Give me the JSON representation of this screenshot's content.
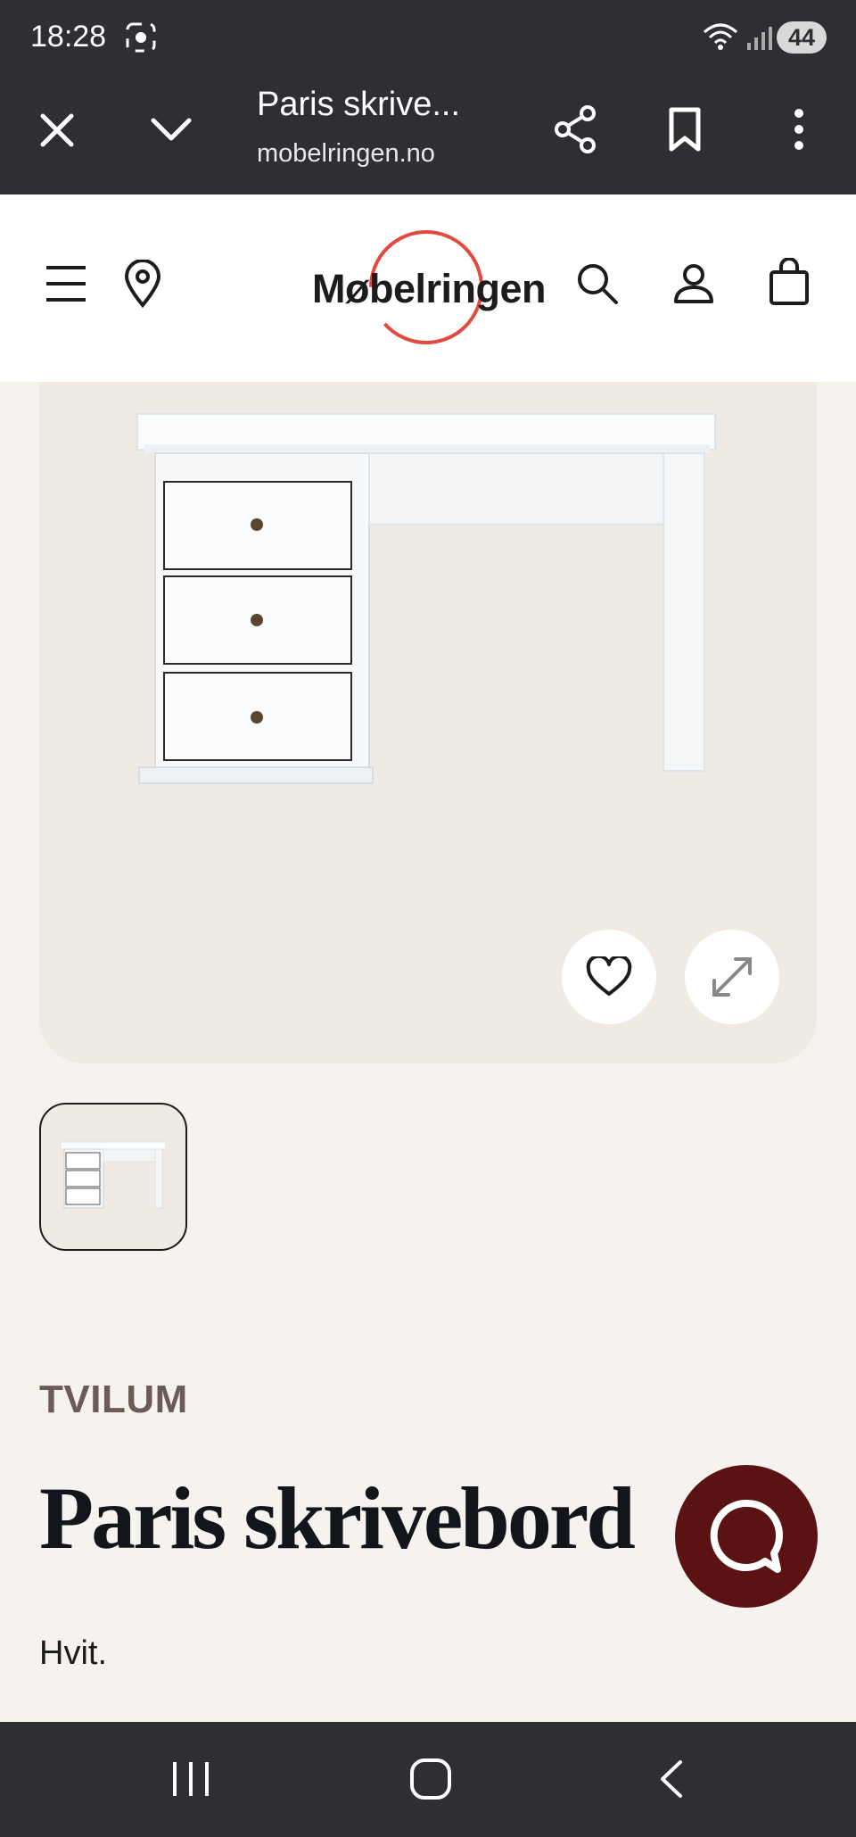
{
  "status_bar": {
    "time": "18:28",
    "battery": "44",
    "icons": [
      "screen-record-icon",
      "wifi-icon",
      "signal-icon"
    ]
  },
  "browser_bar": {
    "title": "Paris skrive...",
    "url": "mobelringen.no",
    "icons": [
      "close-icon",
      "chevron-down-icon",
      "share-icon",
      "bookmark-icon",
      "more-icon"
    ]
  },
  "site_header": {
    "logo_text": "Møbelringen",
    "logo_accent": "#e34a3f",
    "icons": [
      "menu-icon",
      "location-pin-icon",
      "search-icon",
      "account-icon",
      "bag-icon"
    ]
  },
  "product": {
    "brand": "TVILUM",
    "title": "Paris skrivebord",
    "color": "Hvit.",
    "image_actions": [
      "favorite-icon",
      "expand-icon"
    ],
    "thumbnail_count": 1
  },
  "chat": {
    "color": "#5b1212",
    "icon": "chat-icon"
  },
  "nav_bar": {
    "icons": [
      "recent-apps-icon",
      "home-icon",
      "back-icon"
    ]
  }
}
